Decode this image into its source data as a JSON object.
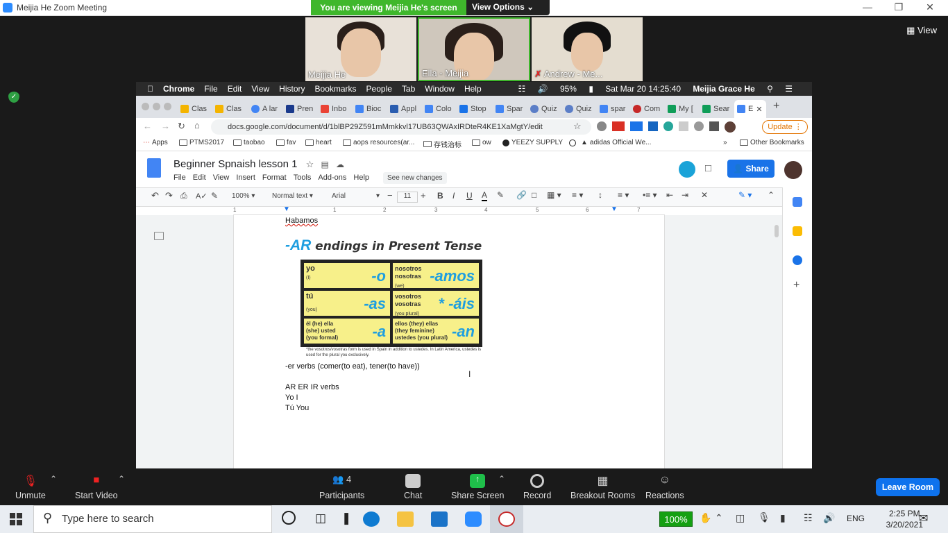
{
  "zoom": {
    "window_title": "Meijia He   Zoom Meeting",
    "viewing_banner": "You are viewing Meijia He's screen",
    "view_options": "View Options ⌄",
    "view_button": "View",
    "participants_videos": [
      {
        "label": "Meijia He"
      },
      {
        "label": "Ella - Meijia"
      },
      {
        "label": "Andrew - Me..."
      }
    ],
    "controls": {
      "unmute": "Unmute",
      "start_video": "Start Video",
      "participants": "Participants",
      "participants_count": "4",
      "chat": "Chat",
      "share_screen": "Share Screen",
      "record": "Record",
      "breakout_rooms": "Breakout Rooms",
      "reactions": "Reactions",
      "leave_room": "Leave Room"
    }
  },
  "mac_menubar": {
    "app": "Chrome",
    "menus": [
      "File",
      "Edit",
      "View",
      "History",
      "Bookmarks",
      "People",
      "Tab",
      "Window",
      "Help"
    ],
    "battery": "95%",
    "clock": "Sat Mar 20  14:25:40",
    "user": "Meijia Grace He"
  },
  "chrome": {
    "tabs": [
      "Clas",
      "Clas",
      "A lar",
      "Pren",
      "Inbo",
      "Bioc",
      "Appl",
      "Colo",
      "Stop",
      "Spar",
      "Quiz",
      "Quiz",
      "spar",
      "Com",
      "My [",
      "Sear",
      "E"
    ],
    "url": "docs.google.com/document/d/1blBP29Z591mMmkkvl17UB63QWAxIRDteR4KE1XaMgtY/edit",
    "update_button": "Update",
    "bookmarks": [
      "Apps",
      "PTMS2017",
      "taobao",
      "fav",
      "heart",
      "aops resources(ar...",
      "存钱治标",
      "ow",
      "YEEZY SUPPLY",
      "adidas Official We...",
      "Other Bookmarks"
    ],
    "bookmarks_more": "»"
  },
  "docs": {
    "title": "Beginner Spnaish lesson 1",
    "menu": [
      "File",
      "Edit",
      "View",
      "Insert",
      "Format",
      "Tools",
      "Add-ons",
      "Help"
    ],
    "see_new_changes": "See new changes",
    "share": "Share",
    "toolbar": {
      "zoom": "100%",
      "style": "Normal text",
      "font": "Arial",
      "size": "11"
    },
    "ruler_marks": [
      "1",
      "1",
      "2",
      "3",
      "4",
      "5",
      "6",
      "7"
    ],
    "body": {
      "line_habamos": "Habamos",
      "ar_title_big": "-AR",
      "ar_title_rest": "endings in Present Tense",
      "table": [
        {
          "pron": "yo",
          "sub": "(I)",
          "end": "-o"
        },
        {
          "pron": "nosotros nosotras",
          "sub": "(we)",
          "end": "-amos"
        },
        {
          "pron": "tú",
          "sub": "(you)",
          "end": "-as"
        },
        {
          "pron": "vosotros vosotras",
          "sub": "(you plural)",
          "end": "* -áis"
        },
        {
          "pron": "él (he) ella (she) usted (you formal)",
          "sub": "",
          "end": "-a"
        },
        {
          "pron": "ellos (they) ellas (they feminine) ustedes (you plural)",
          "sub": "",
          "end": "-an"
        }
      ],
      "note": "*the vosotros/vosotras form is used in Spain in addition to ustedes. In Latin America, ustedes is used for the plural you exclusively.",
      "line_er": "-er verbs (comer(to eat), tener(to have))",
      "line_arerir": "AR ER IR verbs",
      "line_yo": "Yo I",
      "line_tu": "Tú You"
    }
  },
  "taskbar": {
    "search_placeholder": "Type here to search",
    "zoom_level": "100%",
    "language": "ENG",
    "time": "2:25 PM",
    "date": "3/20/2021"
  }
}
